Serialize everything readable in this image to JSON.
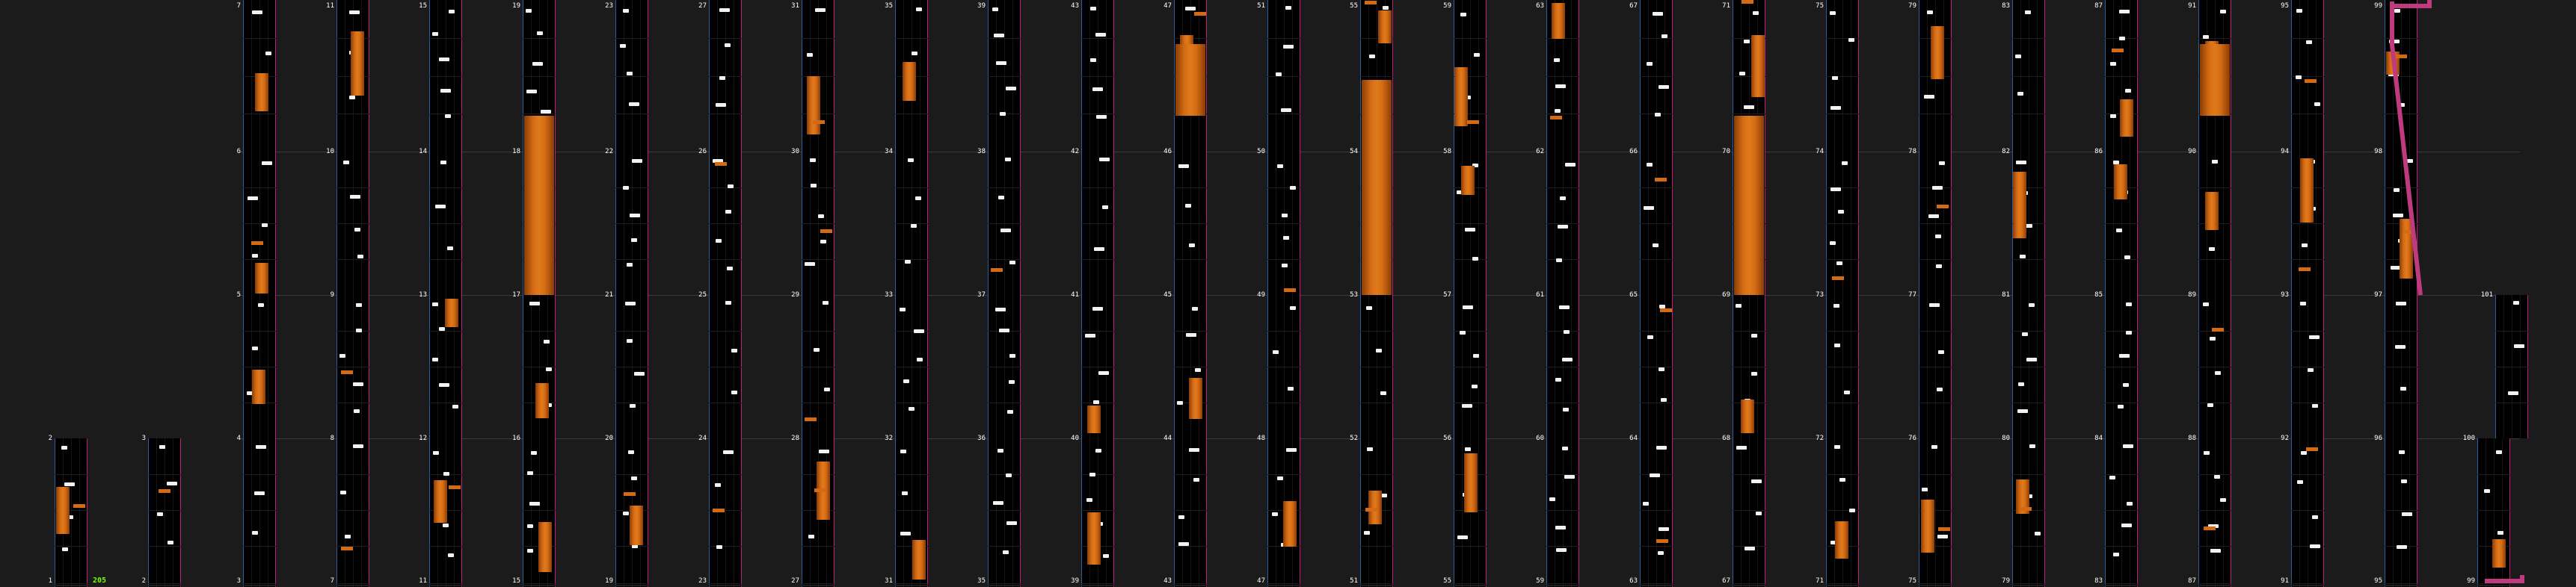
{
  "colors": {
    "background": "#1b1b1b",
    "lane": "#000000",
    "lane_left_edge": "#2b5f9e",
    "lane_right_edge": "#c0207a",
    "tap_note": "#f2f2f2",
    "hold_note": "#d46b14",
    "slide_line": "#c03a7e",
    "combo_text": "#7cfc00"
  },
  "combo": "205",
  "measures": [
    {
      "n": "1",
      "lanes": [
        0,
        0,
        1,
        1,
        0,
        0,
        0,
        0,
        0
      ]
    },
    {
      "n": "2",
      "lanes": [
        0,
        0,
        1,
        0,
        0,
        0,
        0,
        0,
        0
      ]
    },
    {
      "n": "3",
      "lanes": [
        0,
        0,
        0,
        0,
        1,
        0,
        1,
        0,
        0
      ]
    },
    {
      "n": "4",
      "lanes": [
        0,
        0,
        0,
        0,
        0,
        1,
        0,
        1,
        0
      ]
    },
    {
      "n": "5",
      "lanes": [
        0,
        1,
        0,
        1,
        0,
        1,
        0,
        1,
        0
      ]
    },
    {
      "n": "6",
      "lanes": [
        0,
        1,
        0,
        1,
        0,
        1,
        0,
        1,
        0
      ]
    },
    {
      "n": "7",
      "lanes": [
        0,
        0,
        1,
        1,
        0,
        1,
        0,
        1,
        0
      ]
    },
    {
      "n": "8",
      "lanes": [
        0,
        1,
        0,
        1,
        0,
        1,
        0,
        1,
        0
      ]
    },
    {
      "n": "9",
      "lanes": [
        0,
        1,
        0,
        1,
        0,
        1,
        0,
        1,
        0
      ]
    },
    {
      "n": "10",
      "lanes": [
        0,
        1,
        0,
        1,
        0,
        1,
        0,
        1,
        0
      ]
    },
    {
      "n": "11",
      "lanes": [
        0,
        1,
        0,
        1,
        0,
        1,
        0,
        1,
        0
      ]
    },
    {
      "n": "12",
      "lanes": [
        0,
        1,
        0,
        1,
        0,
        1,
        0,
        1,
        0
      ]
    }
  ],
  "labels": {
    "row1": [
      "7",
      "11",
      "15",
      "19",
      "23",
      "27",
      "31",
      "35",
      "39",
      "43",
      "47",
      "51",
      "55",
      "59",
      "63",
      "67",
      "71",
      "75",
      "79",
      "83",
      "87",
      "91",
      "95",
      "99"
    ],
    "row2": [
      "6",
      "10",
      "14",
      "18",
      "22",
      "26",
      "30",
      "34",
      "38",
      "42",
      "46",
      "50",
      "54",
      "58",
      "62",
      "66",
      "70",
      "74",
      "78",
      "82",
      "86",
      "90",
      "94",
      "98"
    ],
    "row3": [
      "5",
      "9",
      "13",
      "17",
      "21",
      "25",
      "29",
      "33",
      "37",
      "41",
      "45",
      "49",
      "53",
      "57",
      "61",
      "65",
      "69",
      "73",
      "77",
      "81",
      "85",
      "89",
      "93",
      "97",
      "101"
    ],
    "row4": [
      "2",
      "3",
      "4",
      "8",
      "12",
      "16",
      "20",
      "24",
      "28",
      "32",
      "36",
      "40",
      "44",
      "48",
      "52",
      "56",
      "60",
      "64",
      "68",
      "72",
      "76",
      "80",
      "84",
      "88",
      "92",
      "96",
      "100"
    ],
    "row5": [
      "1",
      "2",
      "3",
      "7",
      "11",
      "15",
      "19",
      "23",
      "27",
      "31",
      "35",
      "39",
      "43",
      "47",
      "51",
      "55",
      "59",
      "63",
      "67",
      "71",
      "75",
      "79",
      "83",
      "87",
      "91",
      "95",
      "99"
    ]
  }
}
